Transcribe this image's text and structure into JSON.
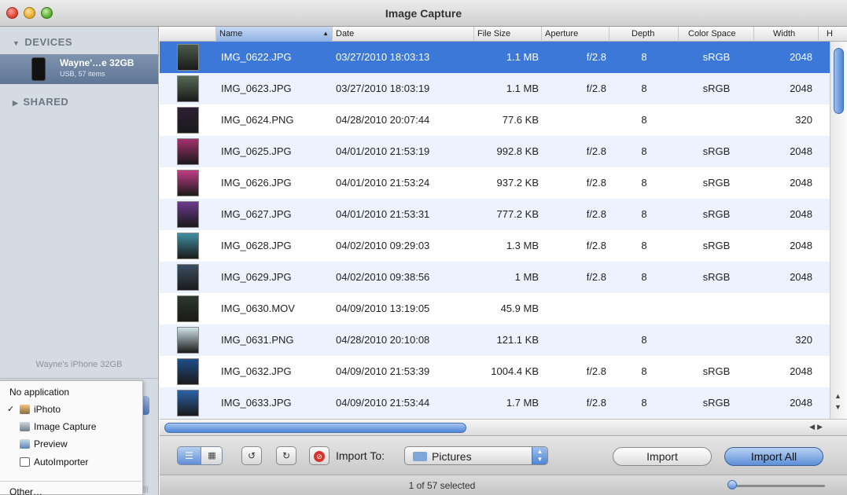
{
  "window": {
    "title": "Image Capture"
  },
  "sidebar": {
    "devices_header": "DEVICES",
    "shared_header": "SHARED",
    "device": {
      "name": "Wayne'…e 32GB",
      "sub": "USB, 57 items"
    },
    "footer_device_name": "Wayne's iPhone 32GB"
  },
  "popup_menu": {
    "items": [
      {
        "label": "No application",
        "checked": false,
        "icon": ""
      },
      {
        "label": "iPhoto",
        "checked": true,
        "icon": "iphoto-icon"
      },
      {
        "label": "Image Capture",
        "checked": false,
        "icon": "image-capture-icon"
      },
      {
        "label": "Preview",
        "checked": false,
        "icon": "preview-icon"
      },
      {
        "label": "AutoImporter",
        "checked": false,
        "icon": "autoimporter-icon"
      },
      {
        "label": "Other…",
        "checked": false,
        "icon": ""
      }
    ],
    "check_mark": "✓"
  },
  "table": {
    "columns": [
      "Name",
      "Date",
      "File Size",
      "Aperture",
      "Depth",
      "Color Space",
      "Width",
      "H"
    ],
    "sorted_column": "Name",
    "rows": [
      {
        "name": "IMG_0622.JPG",
        "date": "03/27/2010 18:03:13",
        "size": "1.1 MB",
        "aperture": "f/2.8",
        "depth": "8",
        "space": "sRGB",
        "width": "2048",
        "thumb": "#4b5b4a",
        "selected": true
      },
      {
        "name": "IMG_0623.JPG",
        "date": "03/27/2010 18:03:19",
        "size": "1.1 MB",
        "aperture": "f/2.8",
        "depth": "8",
        "space": "sRGB",
        "width": "2048",
        "thumb": "#556a55",
        "selected": false
      },
      {
        "name": "IMG_0624.PNG",
        "date": "04/28/2010 20:07:44",
        "size": "77.6 KB",
        "aperture": "",
        "depth": "8",
        "space": "",
        "width": "320",
        "thumb": "#2d1f35",
        "selected": false
      },
      {
        "name": "IMG_0625.JPG",
        "date": "04/01/2010 21:53:19",
        "size": "992.8 KB",
        "aperture": "f/2.8",
        "depth": "8",
        "space": "sRGB",
        "width": "2048",
        "thumb": "#a5306f",
        "selected": false
      },
      {
        "name": "IMG_0626.JPG",
        "date": "04/01/2010 21:53:24",
        "size": "937.2 KB",
        "aperture": "f/2.8",
        "depth": "8",
        "space": "sRGB",
        "width": "2048",
        "thumb": "#c23d86",
        "selected": false
      },
      {
        "name": "IMG_0627.JPG",
        "date": "04/01/2010 21:53:31",
        "size": "777.2 KB",
        "aperture": "f/2.8",
        "depth": "8",
        "space": "sRGB",
        "width": "2048",
        "thumb": "#6b3a8e",
        "selected": false
      },
      {
        "name": "IMG_0628.JPG",
        "date": "04/02/2010 09:29:03",
        "size": "1.3 MB",
        "aperture": "f/2.8",
        "depth": "8",
        "space": "sRGB",
        "width": "2048",
        "thumb": "#3f8fa3",
        "selected": false
      },
      {
        "name": "IMG_0629.JPG",
        "date": "04/02/2010 09:38:56",
        "size": "1 MB",
        "aperture": "f/2.8",
        "depth": "8",
        "space": "sRGB",
        "width": "2048",
        "thumb": "#3c4f62",
        "selected": false
      },
      {
        "name": "IMG_0630.MOV",
        "date": "04/09/2010 13:19:05",
        "size": "45.9 MB",
        "aperture": "",
        "depth": "",
        "space": "",
        "width": "",
        "thumb": "#2a3a2c",
        "selected": false
      },
      {
        "name": "IMG_0631.PNG",
        "date": "04/28/2010 20:10:08",
        "size": "121.1 KB",
        "aperture": "",
        "depth": "8",
        "space": "",
        "width": "320",
        "thumb": "#cfe3e8",
        "selected": false
      },
      {
        "name": "IMG_0632.JPG",
        "date": "04/09/2010 21:53:39",
        "size": "1004.4 KB",
        "aperture": "f/2.8",
        "depth": "8",
        "space": "sRGB",
        "width": "2048",
        "thumb": "#1e4f88",
        "selected": false
      },
      {
        "name": "IMG_0633.JPG",
        "date": "04/09/2010 21:53:44",
        "size": "1.7 MB",
        "aperture": "f/2.8",
        "depth": "8",
        "space": "sRGB",
        "width": "2048",
        "thumb": "#2a62a8",
        "selected": false
      }
    ]
  },
  "toolbar": {
    "import_to_label": "Import To:",
    "destination": "Pictures",
    "import_label": "Import",
    "import_all_label": "Import All"
  },
  "status": {
    "text": "1 of 57 selected"
  },
  "colors": {
    "selection": "#3b78d7",
    "alt_row": "#edf3fe",
    "sidebar": "#d5dbe3"
  }
}
